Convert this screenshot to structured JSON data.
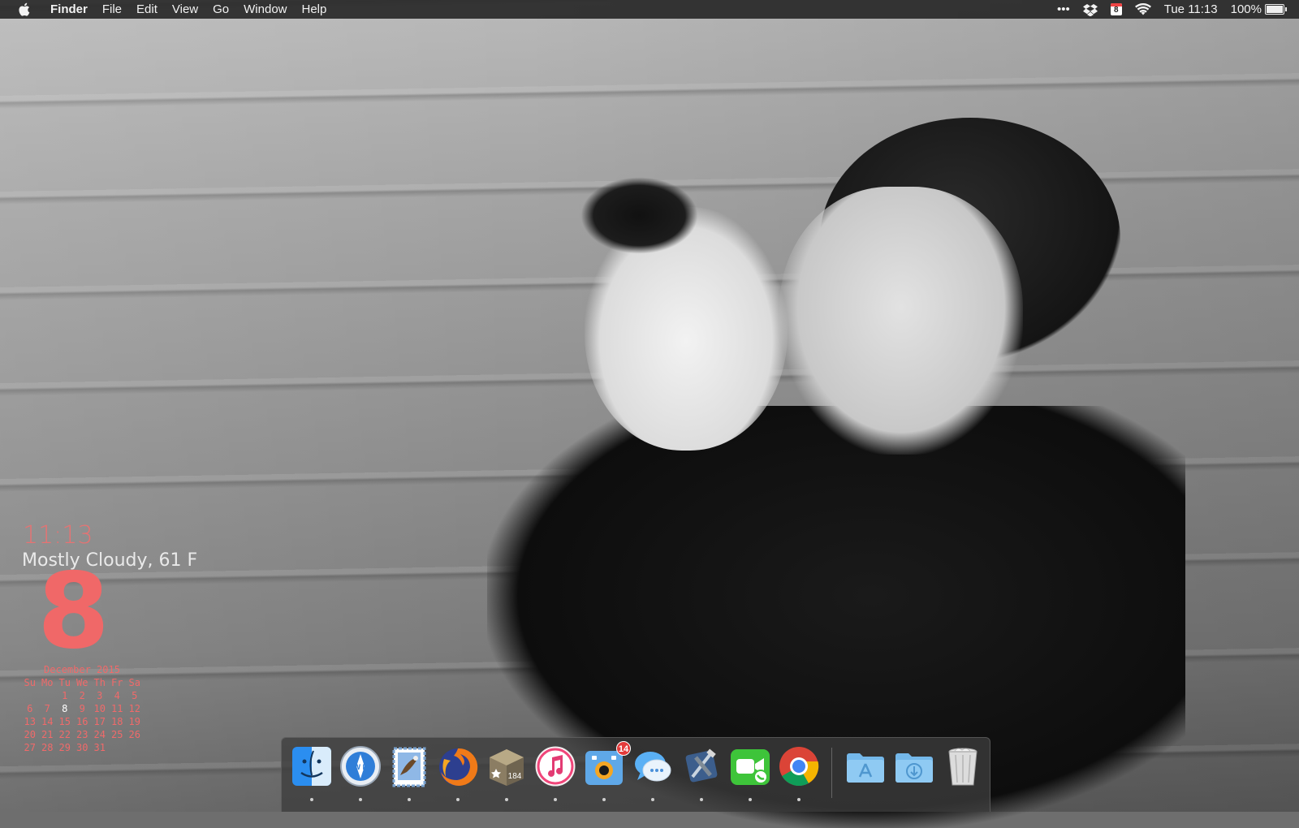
{
  "menubar": {
    "app_name": "Finder",
    "menus": [
      "File",
      "Edit",
      "View",
      "Go",
      "Window",
      "Help"
    ],
    "status": {
      "more": "•••",
      "calendar_day": "8",
      "clock": "Tue 11:13",
      "battery": "100%"
    }
  },
  "widgets": {
    "time": "11:13",
    "weather": "Mostly Cloudy, 61 F",
    "day": "8",
    "calendar": {
      "month": "December 2015",
      "weekdays": [
        "Su",
        "Mo",
        "Tu",
        "We",
        "Th",
        "Fr",
        "Sa"
      ],
      "days": [
        "",
        "",
        "1",
        "2",
        "3",
        "4",
        "5",
        "6",
        "7",
        "8",
        "9",
        "10",
        "11",
        "12",
        "13",
        "14",
        "15",
        "16",
        "17",
        "18",
        "19",
        "20",
        "21",
        "22",
        "23",
        "24",
        "25",
        "26",
        "27",
        "28",
        "29",
        "30",
        "31",
        "",
        ""
      ],
      "today": "8"
    }
  },
  "dock": {
    "apps": [
      {
        "name": "finder-icon",
        "running": true
      },
      {
        "name": "network-radar-icon",
        "running": true
      },
      {
        "name": "mail-icon",
        "running": true
      },
      {
        "name": "firefox-icon",
        "running": true
      },
      {
        "name": "omnifocus-icon",
        "running": true,
        "label": "184"
      },
      {
        "name": "itunes-icon",
        "running": true
      },
      {
        "name": "photo-booth-icon",
        "running": true,
        "badge": "14"
      },
      {
        "name": "messages-icon",
        "running": true
      },
      {
        "name": "xcode-icon",
        "running": true
      },
      {
        "name": "facetime-icon",
        "running": true
      },
      {
        "name": "chrome-icon",
        "running": true
      },
      {
        "name": "applications-folder-icon",
        "running": false
      },
      {
        "name": "downloads-folder-icon",
        "running": false
      },
      {
        "name": "trash-icon",
        "running": false
      }
    ]
  },
  "colors": {
    "widget_accent": "#f06868",
    "menubar_bg": "#282828"
  }
}
